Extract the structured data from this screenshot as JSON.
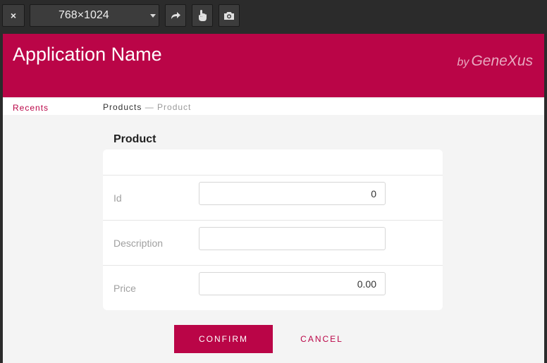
{
  "toolbar": {
    "close_glyph": "×",
    "device_size": "768×1024",
    "icons": [
      "close-icon",
      "chevron-down-icon",
      "rotate-icon",
      "touch-icon",
      "camera-icon"
    ]
  },
  "header": {
    "app_name": "Application Name",
    "brand_by": "by",
    "brand_name": "GeneXus"
  },
  "nav": {
    "recents": "Recents",
    "breadcrumb_parent": "Products",
    "breadcrumb_separator": " — ",
    "breadcrumb_current": "Product"
  },
  "form": {
    "title": "Product",
    "fields": [
      {
        "label": "Id",
        "value": "0"
      },
      {
        "label": "Description",
        "value": ""
      },
      {
        "label": "Price",
        "value": "0.00"
      }
    ]
  },
  "actions": {
    "confirm": "CONFIRM",
    "cancel": "CANCEL"
  },
  "colors": {
    "brand": "#ba0547",
    "page_background": "#f4f4f4",
    "toolbar_background": "#2b2b2b"
  }
}
